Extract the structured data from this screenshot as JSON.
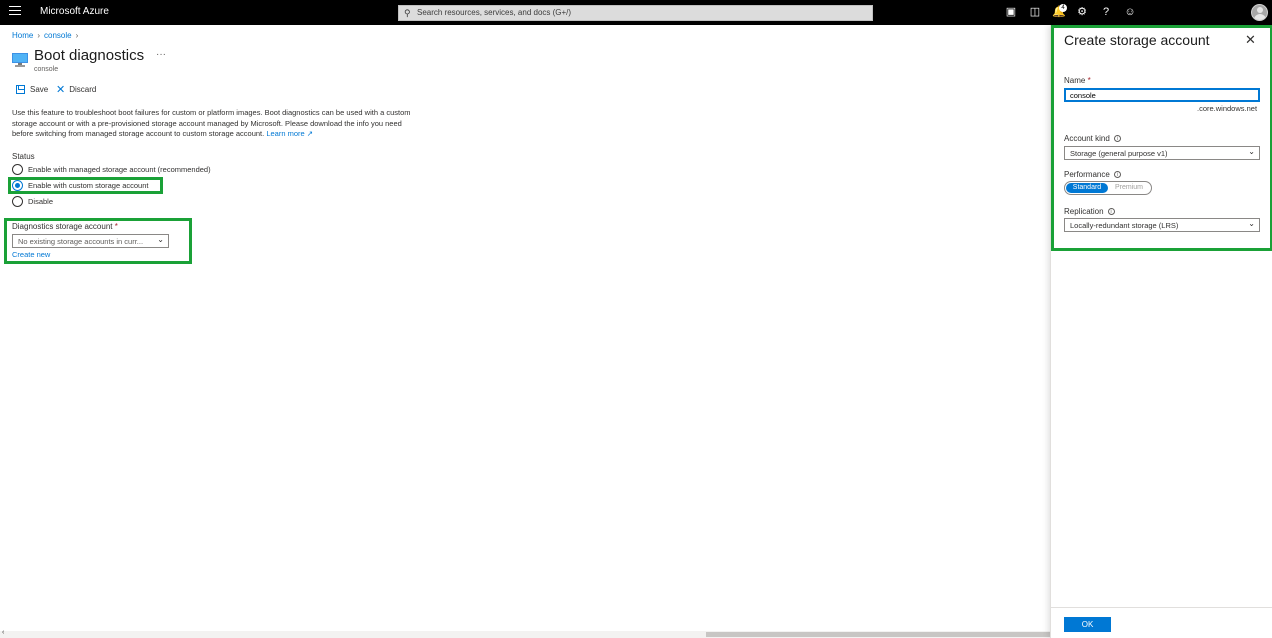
{
  "topbar": {
    "brand": "Microsoft Azure",
    "search_placeholder": "Search resources, services, and docs (G+/)",
    "notification_count": "4"
  },
  "breadcrumb": {
    "home": "Home",
    "resource": "console"
  },
  "page": {
    "title": "Boot diagnostics",
    "more": "···",
    "subtitle": "console"
  },
  "toolbar": {
    "save_label": "Save",
    "discard_label": "Discard"
  },
  "description": {
    "text": "Use this feature to troubleshoot boot failures for custom or platform images. Boot diagnostics can be used with a custom storage account or with a pre-provisioned storage account managed by Microsoft. Please download the info you need before switching from managed storage account to custom storage account. ",
    "link": "Learn more"
  },
  "status": {
    "label": "Status",
    "options": [
      {
        "label": "Enable with managed storage account (recommended)",
        "selected": false
      },
      {
        "label": "Enable with custom storage account",
        "selected": true
      },
      {
        "label": "Disable",
        "selected": false
      }
    ]
  },
  "diagnostics": {
    "label": "Diagnostics storage account",
    "required": "*",
    "selected_value": "No existing storage accounts in curr...",
    "create_new": "Create new"
  },
  "panel": {
    "title": "Create storage account",
    "name_label": "Name",
    "name_required": "*",
    "name_value": "console",
    "name_suffix": ".core.windows.net",
    "account_kind_label": "Account kind",
    "account_kind_value": "Storage (general purpose v1)",
    "performance_label": "Performance",
    "performance_options": [
      "Standard",
      "Premium"
    ],
    "performance_selected": "Standard",
    "replication_label": "Replication",
    "replication_value": "Locally-redundant storage (LRS)",
    "ok_label": "OK"
  },
  "colors": {
    "accent": "#0078d4",
    "highlight": "#1aa137",
    "topbar": "#000000"
  }
}
